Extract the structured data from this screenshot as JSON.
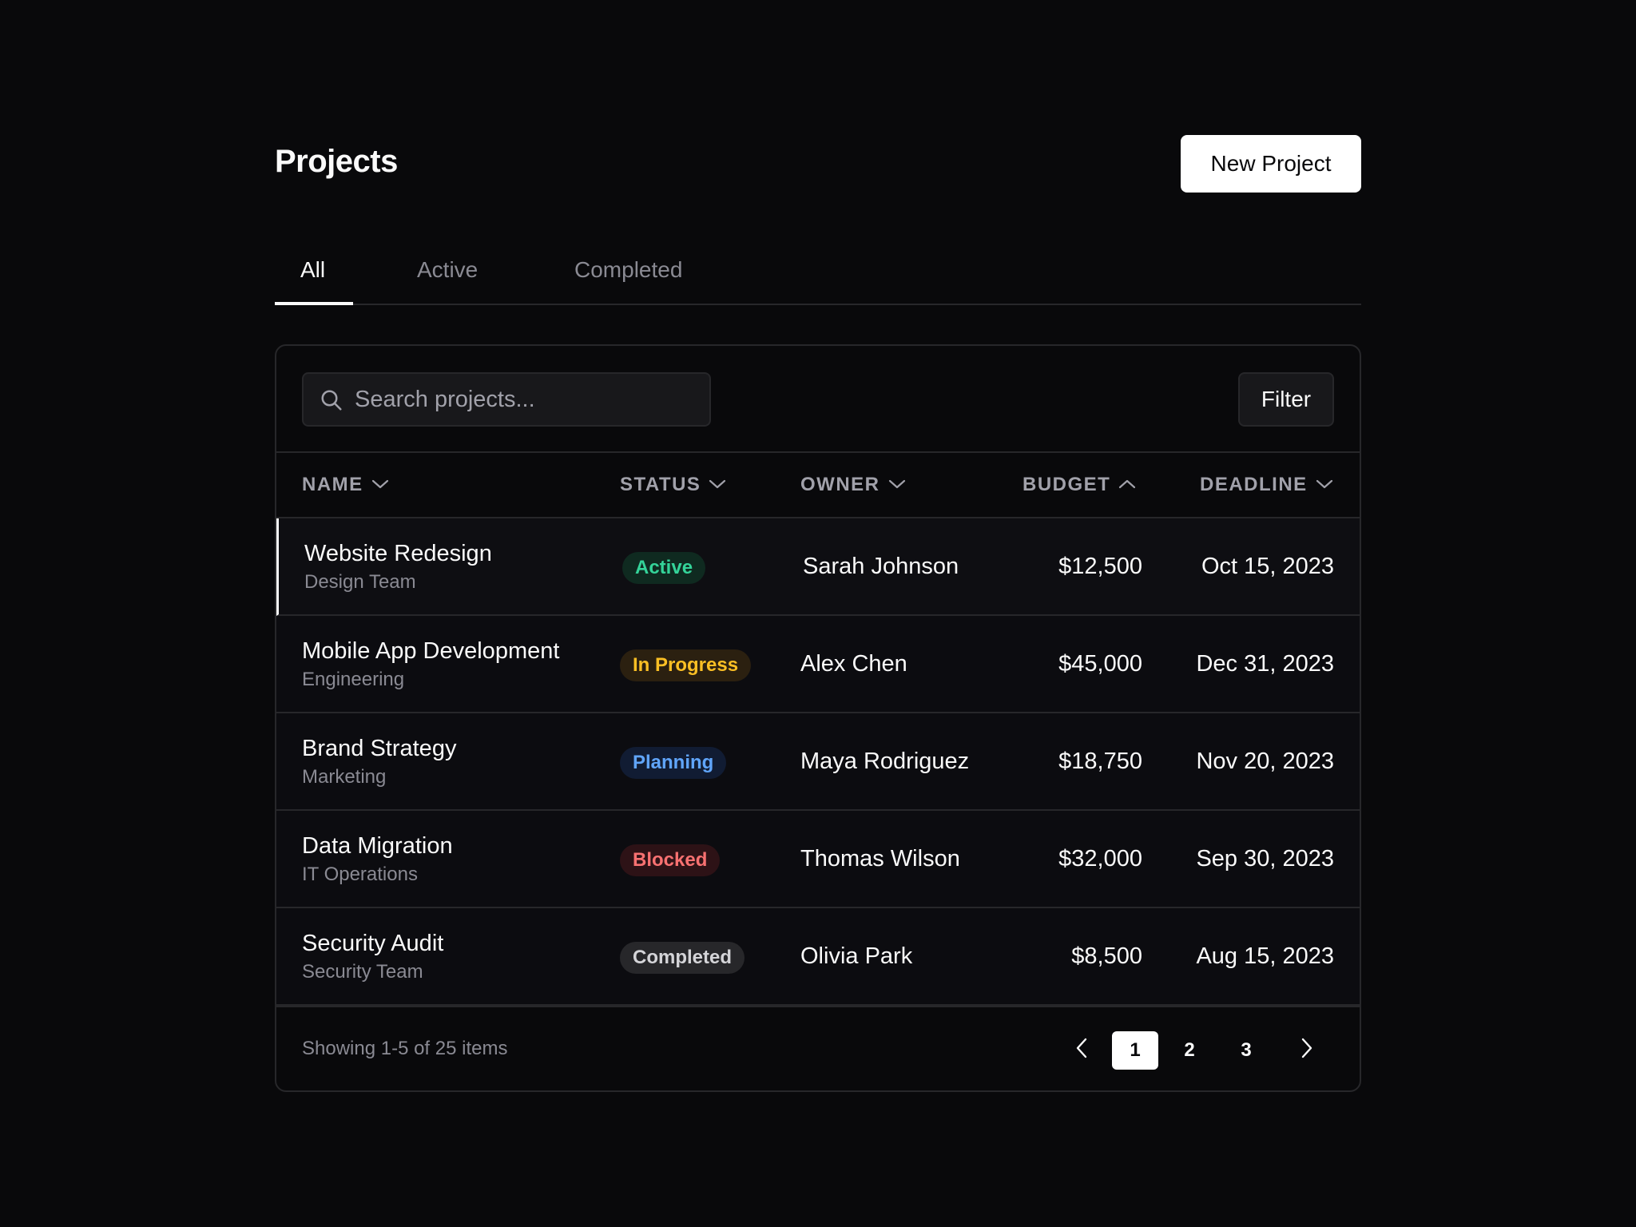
{
  "header": {
    "title": "Projects",
    "new_button": "New Project"
  },
  "tabs": [
    {
      "label": "All",
      "active": true
    },
    {
      "label": "Active",
      "active": false
    },
    {
      "label": "Completed",
      "active": false
    }
  ],
  "search": {
    "placeholder": "Search projects...",
    "value": ""
  },
  "filter_label": "Filter",
  "columns": {
    "name": {
      "label": "NAME",
      "sort": "chevron-down-icon"
    },
    "status": {
      "label": "STATUS",
      "sort": "chevron-down-icon"
    },
    "owner": {
      "label": "OWNER",
      "sort": "chevron-down-icon"
    },
    "budget": {
      "label": "BUDGET",
      "sort": "chevron-up-icon"
    },
    "deadline": {
      "label": "DEADLINE",
      "sort": "chevron-down-icon"
    }
  },
  "rows": [
    {
      "name": "Website Redesign",
      "team": "Design Team",
      "status": "Active",
      "owner": "Sarah Johnson",
      "budget": "$12,500",
      "deadline": "Oct 15, 2023"
    },
    {
      "name": "Mobile App Development",
      "team": "Engineering",
      "status": "In Progress",
      "owner": "Alex Chen",
      "budget": "$45,000",
      "deadline": "Dec 31, 2023"
    },
    {
      "name": "Brand Strategy",
      "team": "Marketing",
      "status": "Planning",
      "owner": "Maya Rodriguez",
      "budget": "$18,750",
      "deadline": "Nov 20, 2023"
    },
    {
      "name": "Data Migration",
      "team": "IT Operations",
      "status": "Blocked",
      "owner": "Thomas Wilson",
      "budget": "$32,000",
      "deadline": "Sep 30, 2023"
    },
    {
      "name": "Security Audit",
      "team": "Security Team",
      "status": "Completed",
      "owner": "Olivia Park",
      "budget": "$8,500",
      "deadline": "Aug 15, 2023"
    }
  ],
  "status_colors": {
    "Active": {
      "fg": "#34d399",
      "bg": "#0f2a20"
    },
    "In Progress": {
      "fg": "#fbbf24",
      "bg": "#2b2010"
    },
    "Planning": {
      "fg": "#60a5fa",
      "bg": "#111c33"
    },
    "Blocked": {
      "fg": "#f87171",
      "bg": "#2d1216"
    },
    "Completed": {
      "fg": "#d4d4d8",
      "bg": "#27272a"
    }
  },
  "pagination": {
    "summary": "Showing 1-5 of 25 items",
    "pages": [
      "1",
      "2",
      "3"
    ],
    "current": "1"
  }
}
